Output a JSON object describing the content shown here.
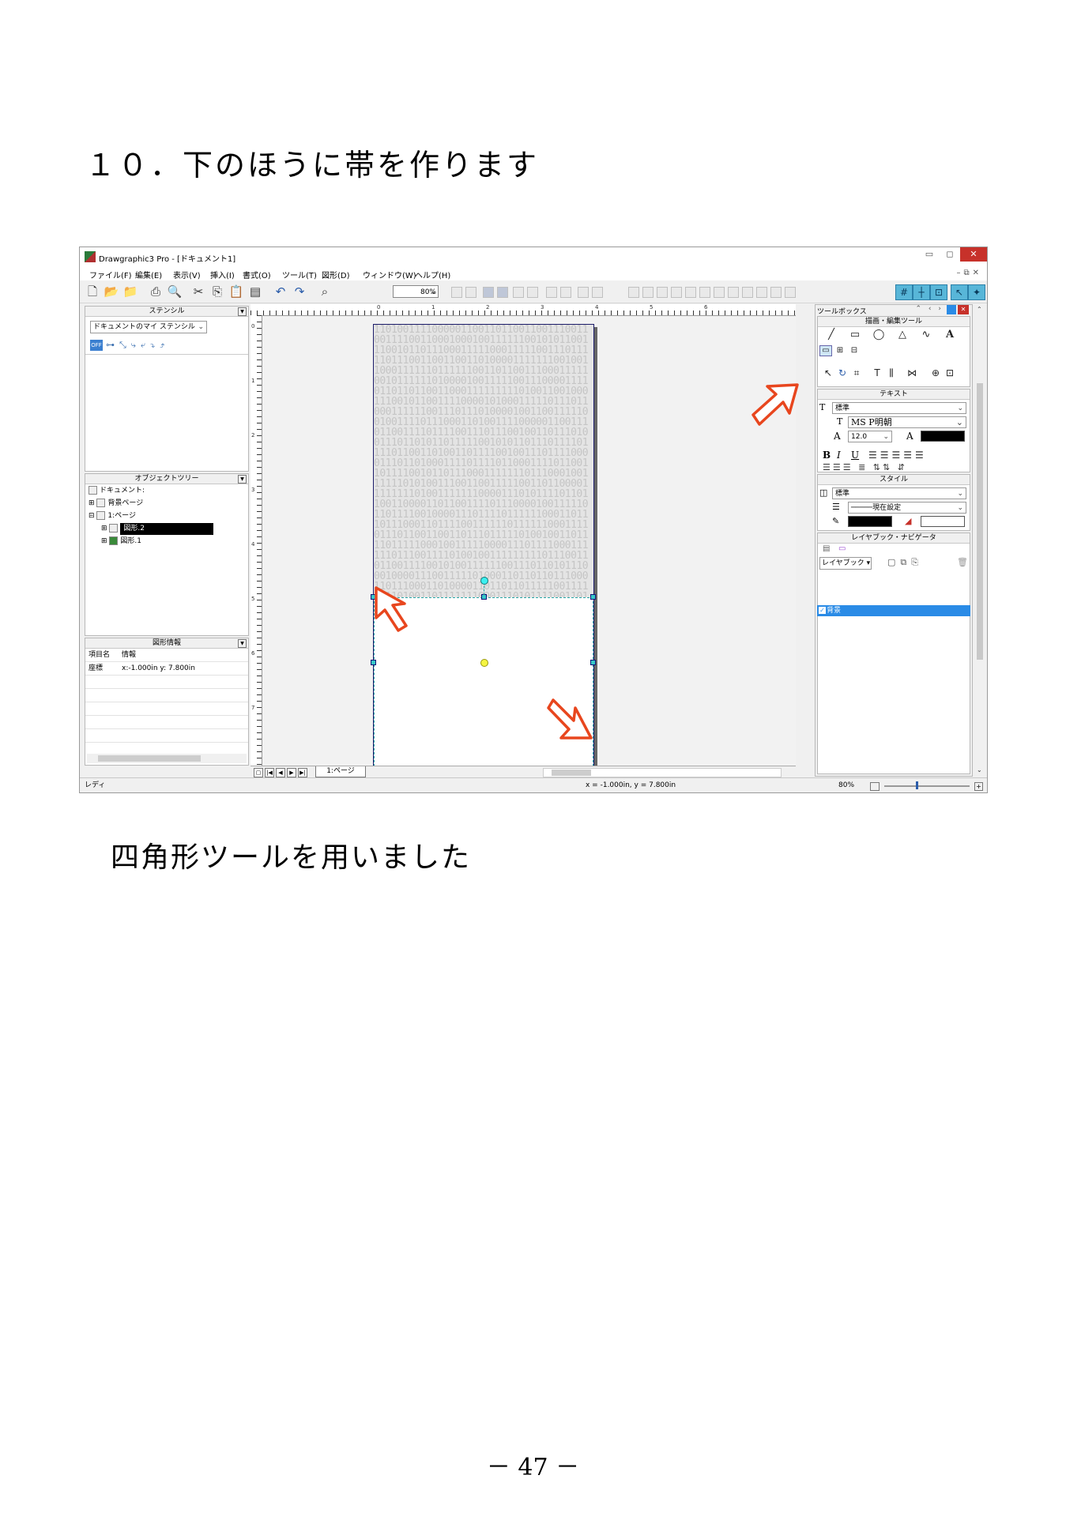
{
  "document": {
    "heading": "１０．下のほうに帯を作ります",
    "caption": "四角形ツールを用いました",
    "page_number": "－ 47 －"
  },
  "app": {
    "title": "Drawgraphic3 Pro - [ドキュメント1]",
    "window_controls": {
      "minimize": "▭",
      "restore": "◻",
      "close": "✕"
    },
    "mdi_controls": "–⧉✕",
    "menu": [
      "ファイル(F)",
      "編集(E)",
      "表示(V)",
      "挿入(I)",
      "書式(O)",
      "ツール(T)",
      "図形(D)",
      "ウィンドウ(W)",
      "ヘルプ(H)"
    ],
    "toolbar": {
      "zoom": "80%"
    }
  },
  "stencil_panel": {
    "title": "ステンシル",
    "selector": "ドキュメントのマイ ステンシル",
    "off_label": "OFF"
  },
  "object_tree": {
    "title": "オブジェクトツリー",
    "items": [
      {
        "label": "ドキュメント:",
        "level": 0,
        "selected": false
      },
      {
        "label": "背景ページ",
        "level": 1,
        "selected": false
      },
      {
        "label": "1:ページ",
        "level": 1,
        "selected": false
      },
      {
        "label": "図形.2",
        "level": 2,
        "selected": true
      },
      {
        "label": "図形.1",
        "level": 2,
        "selected": false
      }
    ]
  },
  "shape_info": {
    "title": "図形情報",
    "col_item": "項目名",
    "col_info": "情報",
    "rows": [
      {
        "name": "座標",
        "value": "x:-1.000in y: 7.800in"
      }
    ]
  },
  "canvas": {
    "ruler_h": [
      "0",
      "1",
      "2",
      "3",
      "4",
      "5",
      "6"
    ],
    "ruler_v": [
      "0",
      "1",
      "2",
      "3",
      "4",
      "5",
      "6",
      "7"
    ],
    "pattern": "1101001111000001100110110011001110011001111001100010001001111110010101100111001011011100011111000111110011101111101110011001100110100001111111001001100011111101111110011011001110001111100101111110100001001111100111000011110110110110011000111111111010011001000111001011001111000010100011111011101100011111100111011101000010011001111100100111101110001101001111000001100111011001111011110011101110010011011101001110110101101111100101011011101111011110110011010011011110010011101111000011101101000111101111011000111101100110111100101101110001111111011100010011111101010011100110011111001101100001111111101001111111000011101011110110110011000011011001111011100001001111101101111001000011101111011111100011011101110001101111001111110111111000111101110110011001101110111110100100110111101111100010011111000011101111000111111011100111101001001111111110111001101100111100101001111110011101101011100010000111001111101000110110110111000110111000110100001101101101111100111110110100110111111100011101011110011011110100111110110111101010011101111111001110011011101001111010011100011111100101001110110110111101111001101110110000110011010001111001111101110001100011100110110010011110001111011111100111110101111110100101111100011000001111111100111000100011111110011100111011011001111101001001101101101101111111000011110111111110011110101100111001110001111101000111111000111111101110111101011010001111101101111011100111010110111111101001100011101111110011011001101011111110100011011001111011110011111111110111111100011111101"
  },
  "page_tabs": {
    "tab": "1:ページ",
    "nav": [
      "|◀",
      "◀",
      "▶",
      "▶|"
    ]
  },
  "toolbox": {
    "title": "ツールボックス",
    "draw_section": "描画・編集ツール",
    "text_section": "テキスト",
    "text_style": "標準",
    "font_name": "MS P明朝",
    "font_size": "12.0",
    "format_buttons": [
      "B",
      "I",
      "U"
    ],
    "style_section": "スタイル",
    "shape_style": "標準",
    "line_setting": "現在設定",
    "layer_section": "レイヤブック・ナビゲータ",
    "layerbook_button": "レイヤブック ▾",
    "layers": [
      {
        "name": "背景",
        "checked": true
      }
    ]
  },
  "status": {
    "left": "レディ",
    "coords": "x = -1.000in, y = 7.800in",
    "zoom": "80%"
  },
  "colors": {
    "accent_arrow": "#e8461e",
    "selection_handle": "#36c7c7",
    "layer_highlight": "#2a8be6",
    "close_button": "#c7312a"
  }
}
